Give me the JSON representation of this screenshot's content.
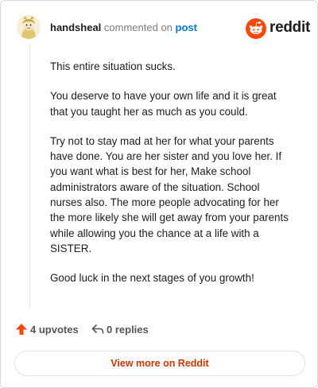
{
  "comment": {
    "author": "handsheal",
    "verb": "commented on",
    "target_link": "post"
  },
  "brand": {
    "name": "reddit",
    "color": "#ff4500"
  },
  "body": {
    "paragraphs": [
      "This entire situation sucks.",
      "You deserve to have your own life and it is great that you taught her as much as you could.",
      "Try not to stay mad at her for what your parents have done. You are her sister and you love her. If you want what is best for her, Make school administrators aware of the situation. School nurses also. The more people advocating for her the more likely she will get away from your parents while allowing you the chance at a life with a SISTER.",
      "Good luck in the next stages of you growth!"
    ]
  },
  "actions": {
    "upvotes_label": "4 upvotes",
    "replies_label": "0 replies"
  },
  "footer": {
    "view_more_label": "View more on Reddit"
  }
}
